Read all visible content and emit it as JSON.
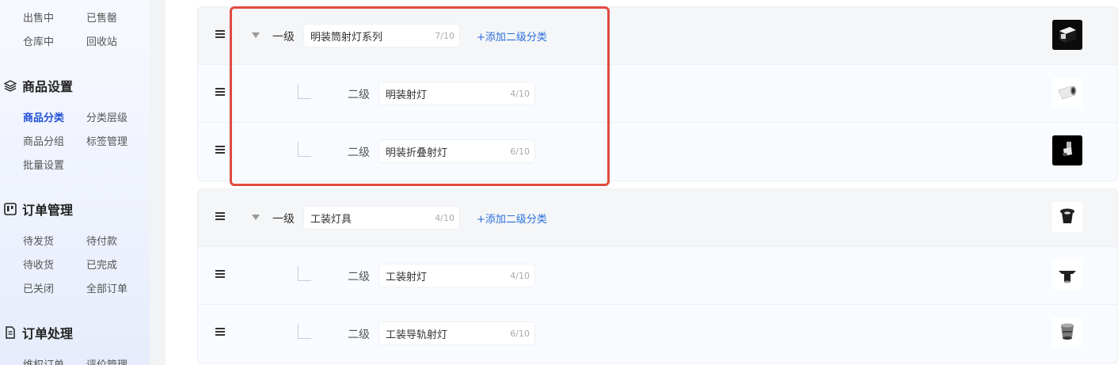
{
  "sidebar": {
    "top_links": [
      "出售中",
      "已售罄",
      "仓库中",
      "回收站"
    ],
    "sections": [
      {
        "title": "商品设置",
        "icon": "layers-icon",
        "links": [
          "商品分类",
          "分类层级",
          "商品分组",
          "标签管理",
          "批量设置"
        ],
        "active": "商品分类"
      },
      {
        "title": "订单管理",
        "icon": "board-icon",
        "links": [
          "待发货",
          "待付款",
          "待收货",
          "已完成",
          "已关闭",
          "全部订单"
        ]
      },
      {
        "title": "订单处理",
        "icon": "document-icon",
        "links": [
          "维权订单",
          "评价管理"
        ]
      }
    ]
  },
  "categories": [
    {
      "level_label": "一级",
      "name": "明装筒射灯系列",
      "count": "7/10",
      "add_label": "+添加二级分类",
      "thumb": "black-box-lamp",
      "children": [
        {
          "level_label": "二级",
          "name": "明装射灯",
          "count": "4/10",
          "thumb": "white-cylinder-lamp"
        },
        {
          "level_label": "二级",
          "name": "明装折叠射灯",
          "count": "6/10",
          "thumb": "folding-spotlight"
        }
      ]
    },
    {
      "level_label": "一级",
      "name": "工装灯具",
      "count": "4/10",
      "add_label": "+添加二级分类",
      "thumb": "black-downlight",
      "children": [
        {
          "level_label": "二级",
          "name": "工装射灯",
          "count": "4/10",
          "thumb": "black-ceiling-spot"
        },
        {
          "level_label": "二级",
          "name": "工装导轨射灯",
          "count": "6/10",
          "thumb": "grey-track-spot"
        }
      ]
    }
  ],
  "colors": {
    "accent": "#1f4fd6",
    "link": "#2a6fdb",
    "highlight_border": "#e04a3f"
  }
}
